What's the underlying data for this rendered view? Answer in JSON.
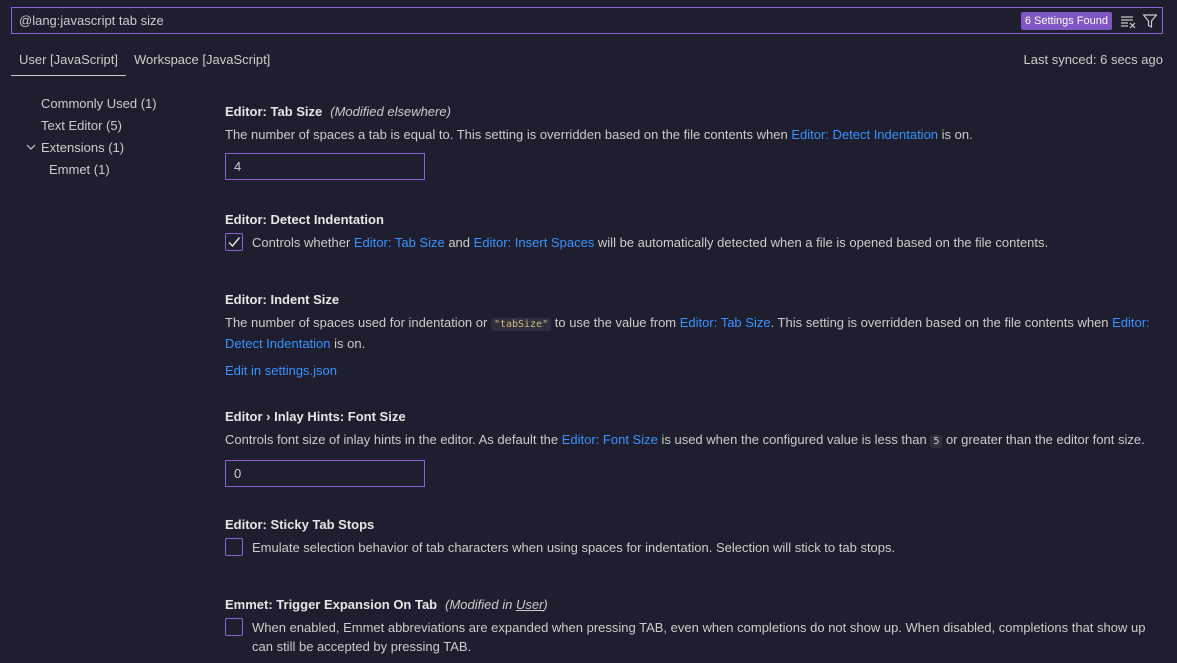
{
  "search": {
    "value": "@lang:javascript tab size",
    "count_label": "6 Settings Found"
  },
  "tabs": [
    {
      "label": "User [JavaScript]"
    },
    {
      "label": "Workspace [JavaScript]"
    }
  ],
  "synced_label": "Last synced: 6 secs ago",
  "toc": [
    {
      "label": "Commonly Used (1)"
    },
    {
      "label": "Text Editor (5)"
    },
    {
      "label": "Extensions (1)"
    },
    {
      "label": "Emmet (1)"
    }
  ],
  "settings": {
    "tab_size": {
      "title": "Editor: Tab Size",
      "modified": "(Modified elsewhere)",
      "desc_before": "The number of spaces a tab is equal to. This setting is overridden based on the file contents when ",
      "desc_link": "Editor: Detect Indentation",
      "desc_after": " is on.",
      "value": "4"
    },
    "detect_indentation": {
      "title": "Editor: Detect Indentation",
      "checked": true,
      "desc_1": "Controls whether ",
      "link_1": "Editor: Tab Size",
      "desc_2": " and ",
      "link_2": "Editor: Insert Spaces",
      "desc_3": " will be automatically detected when a file is opened based on the file contents."
    },
    "indent_size": {
      "title": "Editor: Indent Size",
      "desc_1": "The number of spaces used for indentation or ",
      "code": "\"tabSize\"",
      "desc_2": " to use the value from ",
      "link_1": "Editor: Tab Size",
      "desc_3": ". This setting is overridden based on the file contents when ",
      "link_2": "Editor: Detect Indentation",
      "desc_4": " is on.",
      "edit_link": "Edit in settings.json"
    },
    "inlay_font_size": {
      "title": "Editor › Inlay Hints: Font Size",
      "desc_1": "Controls font size of inlay hints in the editor. As default the ",
      "link_1": "Editor: Font Size",
      "desc_2": " is used when the configured value is less than ",
      "code": "5",
      "desc_3": " or greater than the editor font size.",
      "value": "0"
    },
    "sticky_tab_stops": {
      "title": "Editor: Sticky Tab Stops",
      "checked": false,
      "desc": "Emulate selection behavior of tab characters when using spaces for indentation. Selection will stick to tab stops."
    },
    "emmet_trigger": {
      "title": "Emmet: Trigger Expansion On Tab",
      "modified_prefix": "(Modified in ",
      "modified_link": "User",
      "modified_suffix": ")",
      "checked": false,
      "desc": "When enabled, Emmet abbreviations are expanded when pressing TAB, even when completions do not show up. When disabled, completions that show up can still be accepted by pressing TAB."
    }
  },
  "colors": {
    "background": "#1e1e2e",
    "accent": "#8a63d2",
    "link": "#3794ff",
    "badge": "#7e57c2"
  },
  "icons": [
    "clear-filter-icon",
    "filter-icon",
    "chevron-down-icon",
    "check-icon"
  ]
}
